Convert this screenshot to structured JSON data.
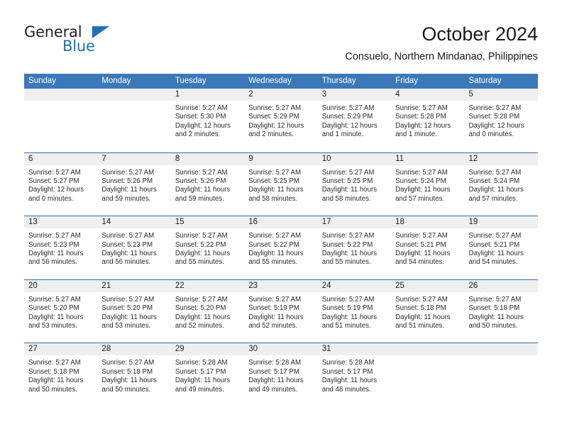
{
  "brand": {
    "name_top": "General",
    "name_bottom": "Blue",
    "color_dark": "#231f20",
    "color_blue": "#1a72bb"
  },
  "header": {
    "title": "October 2024",
    "subtitle": "Consuelo, Northern Mindanao, Philippines"
  },
  "theme": {
    "header_blue": "#3b78b9",
    "row_divider_blue": "#2e6da8",
    "day_band_gray": "#efefef"
  },
  "weekdays": [
    "Sunday",
    "Monday",
    "Tuesday",
    "Wednesday",
    "Thursday",
    "Friday",
    "Saturday"
  ],
  "weeks": [
    [
      {
        "day": "",
        "lines": []
      },
      {
        "day": "",
        "lines": []
      },
      {
        "day": "1",
        "lines": [
          "Sunrise: 5:27 AM",
          "Sunset: 5:30 PM",
          "Daylight: 12 hours and 2 minutes."
        ]
      },
      {
        "day": "2",
        "lines": [
          "Sunrise: 5:27 AM",
          "Sunset: 5:29 PM",
          "Daylight: 12 hours and 2 minutes."
        ]
      },
      {
        "day": "3",
        "lines": [
          "Sunrise: 5:27 AM",
          "Sunset: 5:29 PM",
          "Daylight: 12 hours and 1 minute."
        ]
      },
      {
        "day": "4",
        "lines": [
          "Sunrise: 5:27 AM",
          "Sunset: 5:28 PM",
          "Daylight: 12 hours and 1 minute."
        ]
      },
      {
        "day": "5",
        "lines": [
          "Sunrise: 5:27 AM",
          "Sunset: 5:28 PM",
          "Daylight: 12 hours and 0 minutes."
        ]
      }
    ],
    [
      {
        "day": "6",
        "lines": [
          "Sunrise: 5:27 AM",
          "Sunset: 5:27 PM",
          "Daylight: 12 hours and 0 minutes."
        ]
      },
      {
        "day": "7",
        "lines": [
          "Sunrise: 5:27 AM",
          "Sunset: 5:26 PM",
          "Daylight: 11 hours and 59 minutes."
        ]
      },
      {
        "day": "8",
        "lines": [
          "Sunrise: 5:27 AM",
          "Sunset: 5:26 PM",
          "Daylight: 11 hours and 59 minutes."
        ]
      },
      {
        "day": "9",
        "lines": [
          "Sunrise: 5:27 AM",
          "Sunset: 5:25 PM",
          "Daylight: 11 hours and 58 minutes."
        ]
      },
      {
        "day": "10",
        "lines": [
          "Sunrise: 5:27 AM",
          "Sunset: 5:25 PM",
          "Daylight: 11 hours and 58 minutes."
        ]
      },
      {
        "day": "11",
        "lines": [
          "Sunrise: 5:27 AM",
          "Sunset: 5:24 PM",
          "Daylight: 11 hours and 57 minutes."
        ]
      },
      {
        "day": "12",
        "lines": [
          "Sunrise: 5:27 AM",
          "Sunset: 5:24 PM",
          "Daylight: 11 hours and 57 minutes."
        ]
      }
    ],
    [
      {
        "day": "13",
        "lines": [
          "Sunrise: 5:27 AM",
          "Sunset: 5:23 PM",
          "Daylight: 11 hours and 56 minutes."
        ]
      },
      {
        "day": "14",
        "lines": [
          "Sunrise: 5:27 AM",
          "Sunset: 5:23 PM",
          "Daylight: 11 hours and 56 minutes."
        ]
      },
      {
        "day": "15",
        "lines": [
          "Sunrise: 5:27 AM",
          "Sunset: 5:22 PM",
          "Daylight: 11 hours and 55 minutes."
        ]
      },
      {
        "day": "16",
        "lines": [
          "Sunrise: 5:27 AM",
          "Sunset: 5:22 PM",
          "Daylight: 11 hours and 55 minutes."
        ]
      },
      {
        "day": "17",
        "lines": [
          "Sunrise: 5:27 AM",
          "Sunset: 5:22 PM",
          "Daylight: 11 hours and 55 minutes."
        ]
      },
      {
        "day": "18",
        "lines": [
          "Sunrise: 5:27 AM",
          "Sunset: 5:21 PM",
          "Daylight: 11 hours and 54 minutes."
        ]
      },
      {
        "day": "19",
        "lines": [
          "Sunrise: 5:27 AM",
          "Sunset: 5:21 PM",
          "Daylight: 11 hours and 54 minutes."
        ]
      }
    ],
    [
      {
        "day": "20",
        "lines": [
          "Sunrise: 5:27 AM",
          "Sunset: 5:20 PM",
          "Daylight: 11 hours and 53 minutes."
        ]
      },
      {
        "day": "21",
        "lines": [
          "Sunrise: 5:27 AM",
          "Sunset: 5:20 PM",
          "Daylight: 11 hours and 53 minutes."
        ]
      },
      {
        "day": "22",
        "lines": [
          "Sunrise: 5:27 AM",
          "Sunset: 5:20 PM",
          "Daylight: 11 hours and 52 minutes."
        ]
      },
      {
        "day": "23",
        "lines": [
          "Sunrise: 5:27 AM",
          "Sunset: 5:19 PM",
          "Daylight: 11 hours and 52 minutes."
        ]
      },
      {
        "day": "24",
        "lines": [
          "Sunrise: 5:27 AM",
          "Sunset: 5:19 PM",
          "Daylight: 11 hours and 51 minutes."
        ]
      },
      {
        "day": "25",
        "lines": [
          "Sunrise: 5:27 AM",
          "Sunset: 5:18 PM",
          "Daylight: 11 hours and 51 minutes."
        ]
      },
      {
        "day": "26",
        "lines": [
          "Sunrise: 5:27 AM",
          "Sunset: 5:18 PM",
          "Daylight: 11 hours and 50 minutes."
        ]
      }
    ],
    [
      {
        "day": "27",
        "lines": [
          "Sunrise: 5:27 AM",
          "Sunset: 5:18 PM",
          "Daylight: 11 hours and 50 minutes."
        ]
      },
      {
        "day": "28",
        "lines": [
          "Sunrise: 5:27 AM",
          "Sunset: 5:18 PM",
          "Daylight: 11 hours and 50 minutes."
        ]
      },
      {
        "day": "29",
        "lines": [
          "Sunrise: 5:28 AM",
          "Sunset: 5:17 PM",
          "Daylight: 11 hours and 49 minutes."
        ]
      },
      {
        "day": "30",
        "lines": [
          "Sunrise: 5:28 AM",
          "Sunset: 5:17 PM",
          "Daylight: 11 hours and 49 minutes."
        ]
      },
      {
        "day": "31",
        "lines": [
          "Sunrise: 5:28 AM",
          "Sunset: 5:17 PM",
          "Daylight: 11 hours and 48 minutes."
        ]
      },
      {
        "day": "",
        "lines": []
      },
      {
        "day": "",
        "lines": []
      }
    ]
  ]
}
